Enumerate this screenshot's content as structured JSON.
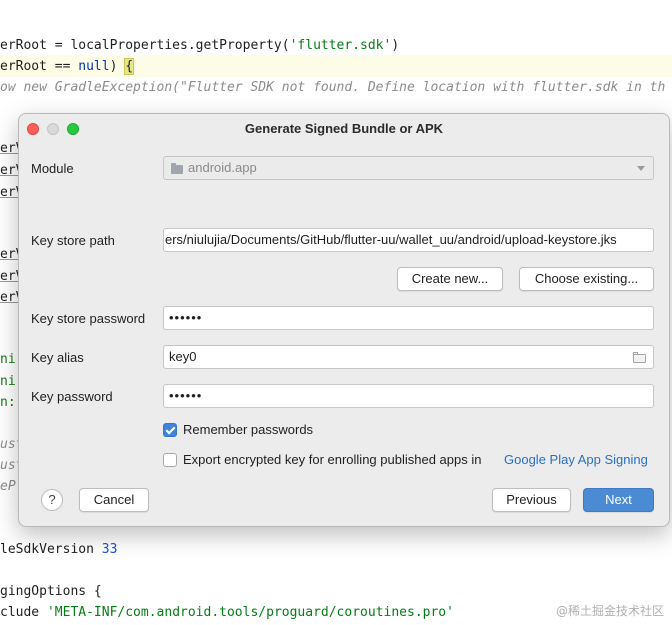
{
  "editor": {
    "line1": {
      "prefix": "erRoot = localProperties.getProperty(",
      "string": "'flutter.sdk'",
      "suffix": ")"
    },
    "line2": {
      "prefix": "erRoot == ",
      "keyword": "null",
      "mid": ") ",
      "brace": "{"
    },
    "line3": {
      "comment": "ow new GradleException(\"Flutter SDK not found. Define location with flutter.sdk in th"
    },
    "line4": {
      "prefix": "leSdkVersion ",
      "number": "33"
    },
    "line5": {
      "prefix": "gingOptions {"
    },
    "line6": {
      "prefix": "clude ",
      "string": "'META-INF/com.android.tools/proguard/coroutines.pro'"
    },
    "fragments": [
      {
        "text": "erV",
        "style": "v"
      },
      {
        "text": "erV",
        "style": "v"
      },
      {
        "text": "erV",
        "style": "v"
      },
      {
        "text": "erV",
        "style": "v"
      },
      {
        "text": "erV",
        "style": "v"
      },
      {
        "text": "erV",
        "style": "v"
      },
      {
        "text": "ni",
        "style": "g"
      },
      {
        "text": "ni",
        "style": "g"
      },
      {
        "text": "n:",
        "style": "g"
      },
      {
        "text": "ust",
        "style": "i"
      },
      {
        "text": "ust",
        "style": "i"
      },
      {
        "text": "eP",
        "style": "i"
      }
    ],
    "watermark": "@稀土掘金技术社区"
  },
  "dialog": {
    "title": "Generate Signed Bundle or APK",
    "module_label": "Module",
    "module_value": "android.app",
    "keystore_path_label": "Key store path",
    "keystore_path_value": "ers/niulujia/Documents/GitHub/flutter-uu/wallet_uu/android/upload-keystore.jks",
    "create_new_label": "Create new...",
    "choose_existing_label": "Choose existing...",
    "keystore_password_label": "Key store password",
    "keystore_password_value": "••••••",
    "key_alias_label": "Key alias",
    "key_alias_value": "key0",
    "key_password_label": "Key password",
    "key_password_value": "••••••",
    "remember_passwords_label": "Remember passwords",
    "remember_passwords_checked": true,
    "export_key_label": "Export encrypted key for enrolling published apps in",
    "export_key_checked": false,
    "export_key_link": "Google Play App Signing",
    "help_label": "?",
    "cancel_label": "Cancel",
    "previous_label": "Previous",
    "next_label": "Next"
  },
  "colors": {
    "primary_button": "#4a8bd4",
    "link": "#2a6fc4",
    "checkbox_checked": "#3f84d8",
    "close": "#ff5f57",
    "zoom": "#28c840"
  }
}
